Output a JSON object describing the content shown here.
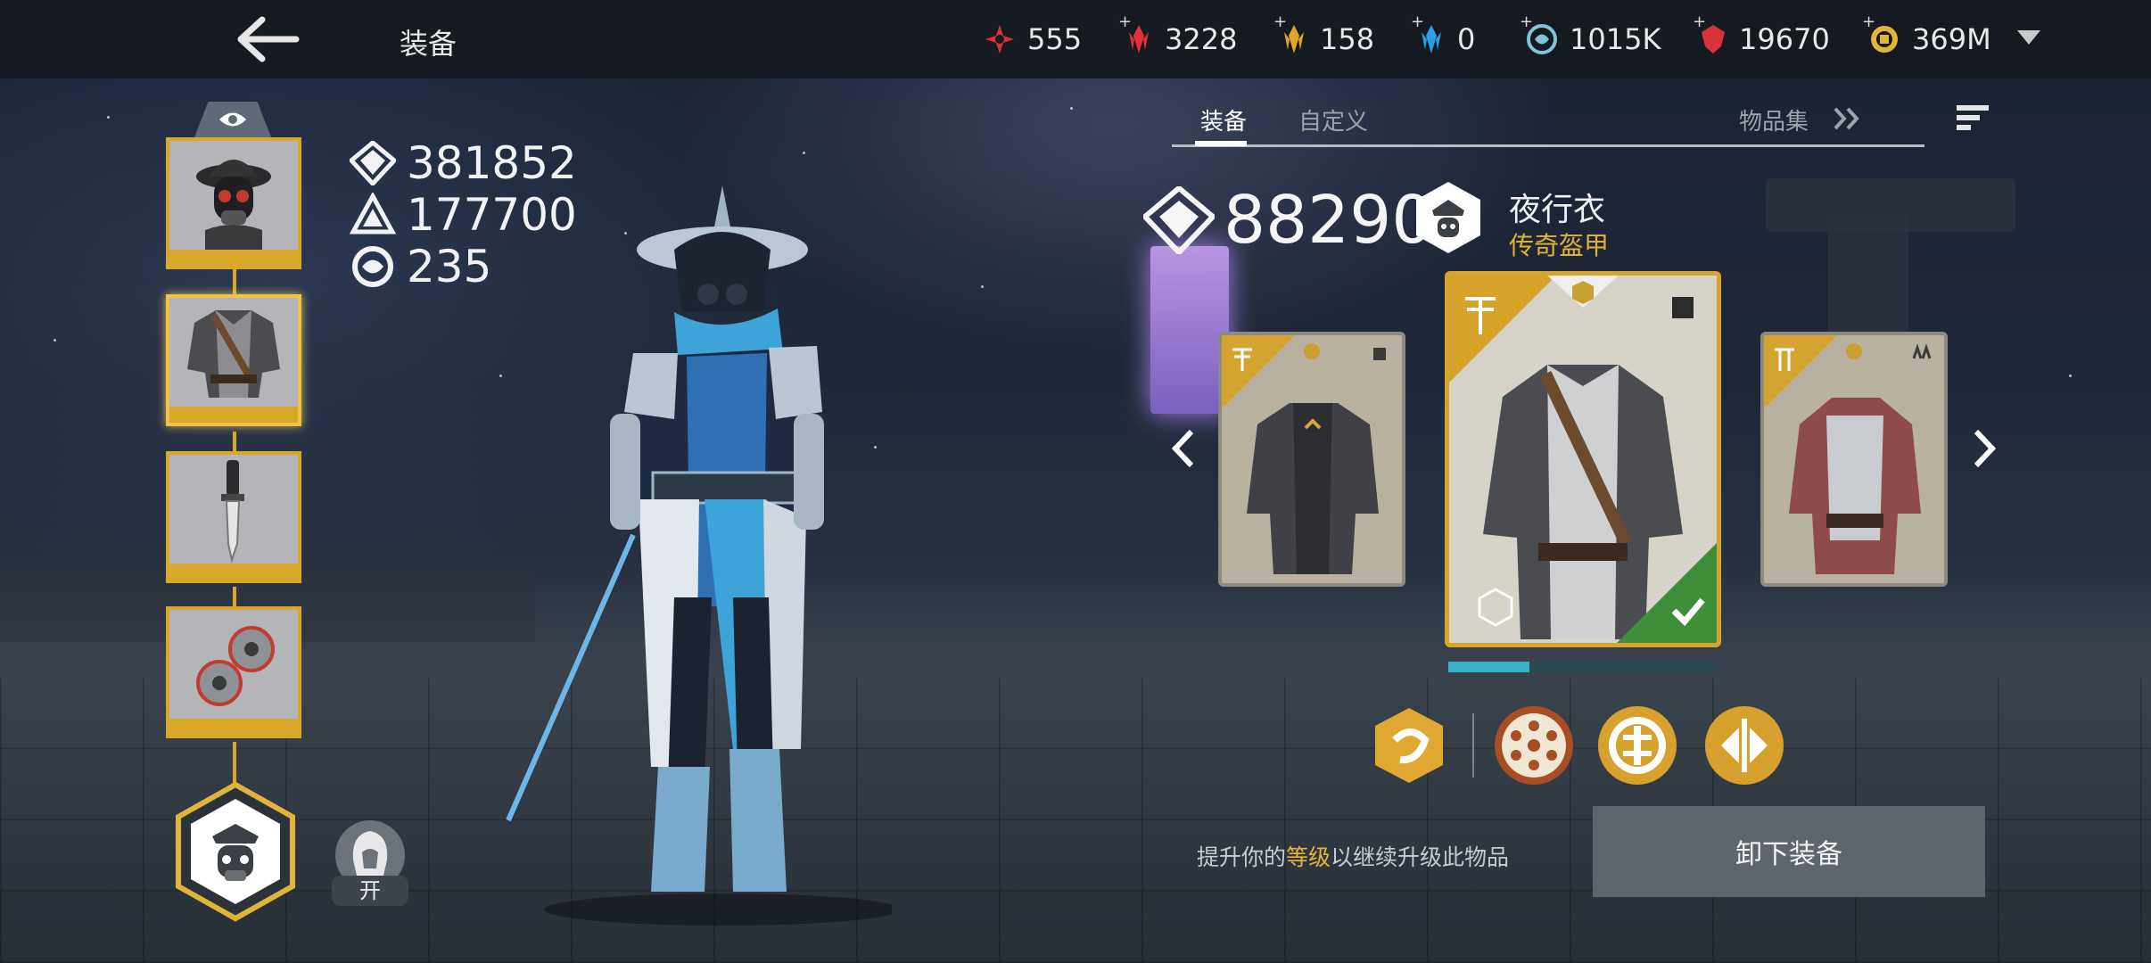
{
  "header": {
    "title": "装备",
    "resources": [
      {
        "name": "red-star-icon",
        "value": "555",
        "color": "#d8323c",
        "has_plus": false
      },
      {
        "name": "red-crystal-icon",
        "value": "3228",
        "color": "#e0313a",
        "has_plus": true
      },
      {
        "name": "gold-crystal-icon",
        "value": "158",
        "color": "#e0a822",
        "has_plus": true
      },
      {
        "name": "blue-crystal-icon",
        "value": "0",
        "color": "#2b9ee6",
        "has_plus": true
      },
      {
        "name": "orb-icon",
        "value": "1015K",
        "color": "#7fc4d8",
        "has_plus": true
      },
      {
        "name": "ruby-icon",
        "value": "19670",
        "color": "#d8323c",
        "has_plus": true
      },
      {
        "name": "coin-icon",
        "value": "369M",
        "color": "#e3b43a",
        "has_plus": true
      }
    ]
  },
  "stats": {
    "power": "381852",
    "defense": "177700",
    "level": "235"
  },
  "toggle": {
    "label": "开"
  },
  "tabs": {
    "equip": "装备",
    "custom": "自定义",
    "collection": "物品集"
  },
  "item": {
    "power": "88290",
    "name": "夜行衣",
    "type": "传奇盔甲",
    "type_color": "#e2b235",
    "upgrade_progress": 0.3
  },
  "hint": {
    "pre": "提升你的",
    "highlight": "等级",
    "post": "以继续升级此物品"
  },
  "buttons": {
    "unequip": "卸下装备"
  }
}
